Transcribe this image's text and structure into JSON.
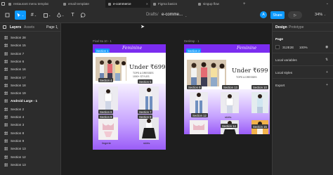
{
  "tabs": [
    {
      "label": "restaurant menu templat"
    },
    {
      "label": "email template"
    },
    {
      "label": "e-commerce"
    },
    {
      "label": "Figma basics"
    },
    {
      "label": "singup flow"
    }
  ],
  "toolbar": {
    "folder": "Drafts",
    "separator": "/",
    "file_name": "e-comme...",
    "avatar_initial": "A",
    "share_label": "Share",
    "play_label": "▷",
    "zoom": "34%"
  },
  "left_panel": {
    "layers_tab": "Layers",
    "assets_tab": "Assets",
    "page_label": "Page 1",
    "layers": [
      "Section 28",
      "Section 15",
      "Section 7",
      "Section 6",
      "Section 16",
      "Section 17",
      "Section 18",
      "Section 19",
      "Android Large - 1",
      "Section 2",
      "Section 4",
      "Section 3",
      "Section 8",
      "Section 9",
      "Section 13",
      "Section 12",
      "Section 13"
    ]
  },
  "canvas": {
    "left_frame": {
      "label": "Pixel 8a 10 - 1",
      "logo": "Feminine",
      "promo_big": "Under ₹699",
      "promo_small": "TOPS & DRESSES",
      "promo_small2": "1000+ STYLES",
      "sections": [
        "Section 1",
        "Section 4",
        "Section 5",
        "Section 6",
        "Section 7",
        "Section 8",
        "Section 9"
      ],
      "captions": [
        "lingerie",
        "skirts"
      ]
    },
    "right_frame": {
      "label": "Desktop - 1",
      "logo": "Feminine",
      "promo_big": "Under ₹699",
      "promo_small": "TOPS & DRESSES",
      "sections": [
        "Section 2",
        "Section 9",
        "Section 13",
        "Section 10",
        "Section 12",
        "Section 14",
        "Section 15"
      ],
      "captions": [
        "skirts"
      ]
    }
  },
  "right_panel": {
    "design_tab": "Design",
    "prototype_tab": "Prototype",
    "page_heading": "Page",
    "page_color": "312E2E",
    "page_opacity": "100%",
    "local_variables": "Local variables",
    "local_styles": "Local styles",
    "export": "Export"
  },
  "colors": {
    "accent": "#0d99ff",
    "brand_purple": "#7b2cf0",
    "page_bg": "#1e1e1e"
  },
  "icons": {
    "move_tool": "cursor-icon",
    "frame_tool": "frame-icon",
    "shape_tool": "rectangle-icon",
    "pen_tool": "pen-icon",
    "text_tool": "text-icon",
    "comment_tool": "comment-icon"
  }
}
